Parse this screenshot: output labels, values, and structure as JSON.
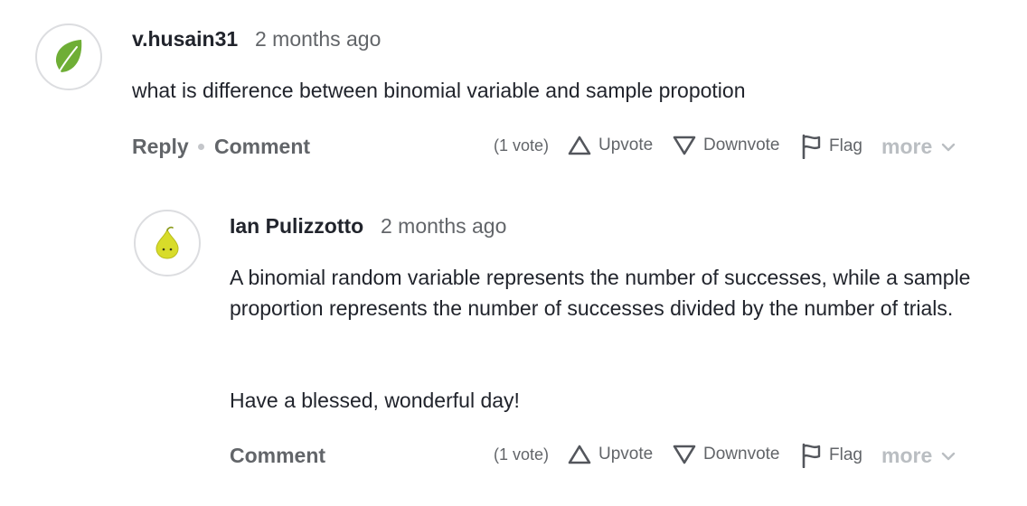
{
  "comment": {
    "author": "v.husain31",
    "time": "2 months ago",
    "text": "what is difference between binomial variable and sample propotion",
    "avatar_icon": "leaf-icon",
    "avatar_color": "#6fae36",
    "actions": {
      "reply": "Reply",
      "comment": "Comment",
      "votes": "(1 vote)",
      "upvote": "Upvote",
      "downvote": "Downvote",
      "flag": "Flag",
      "more": "more"
    }
  },
  "reply": {
    "author": "Ian Pulizzotto",
    "time": "2 months ago",
    "paragraphs": [
      "A binomial random variable represents the number of successes, while a sample proportion represents the number of successes divided by the number of trials.",
      "Have a blessed, wonderful day!"
    ],
    "avatar_icon": "seedling-drop-icon",
    "avatar_color": "#d8dc2a",
    "actions": {
      "comment": "Comment",
      "votes": "(1 vote)",
      "upvote": "Upvote",
      "downvote": "Downvote",
      "flag": "Flag",
      "more": "more"
    }
  }
}
